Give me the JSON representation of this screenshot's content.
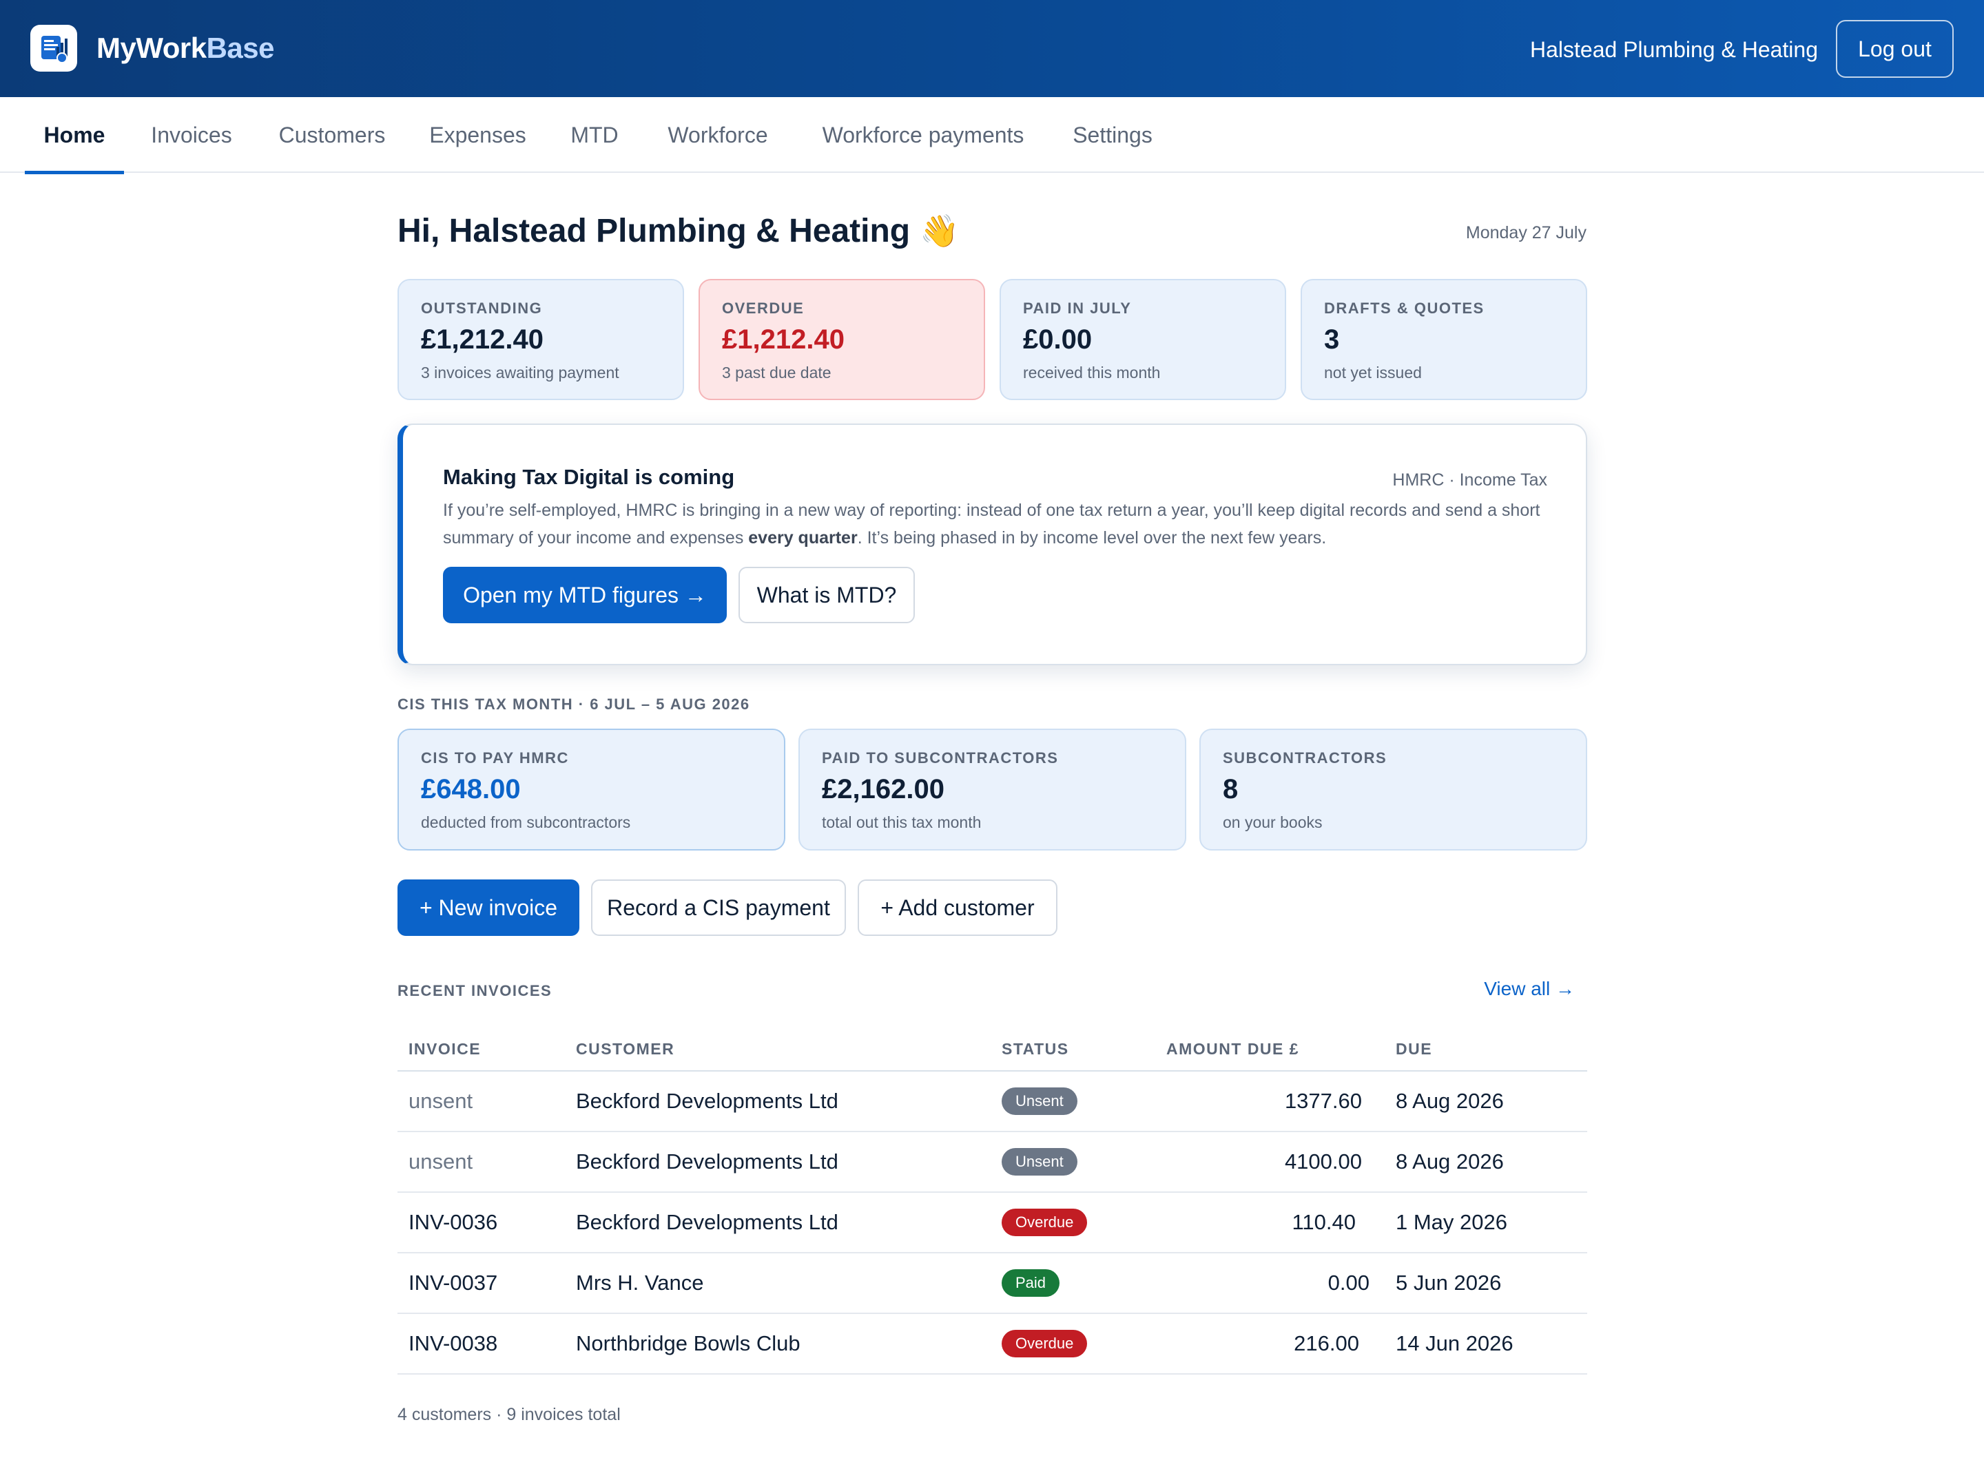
{
  "app": {
    "brand_main": "MyWork",
    "brand_accent": "Base",
    "company": "Halstead Plumbing & Heating",
    "logout_label": "Log out"
  },
  "nav": {
    "items": [
      {
        "label": "Home",
        "active": true
      },
      {
        "label": "Invoices"
      },
      {
        "label": "Customers"
      },
      {
        "label": "Expenses"
      },
      {
        "label": "MTD"
      },
      {
        "label": "Workforce"
      },
      {
        "label": "Workforce payments"
      },
      {
        "label": "Settings"
      }
    ]
  },
  "greeting": {
    "text": "Hi, Halstead Plumbing & Heating",
    "emoji": "👋",
    "date": "Monday 27 July"
  },
  "stats": [
    {
      "label": "OUTSTANDING",
      "value": "£1,212.40",
      "sub": "3 invoices awaiting payment"
    },
    {
      "label": "OVERDUE",
      "value": "£1,212.40",
      "sub": "3 past due date"
    },
    {
      "label": "PAID IN JULY",
      "value": "£0.00",
      "sub": "received this month"
    },
    {
      "label": "DRAFTS & QUOTES",
      "value": "3",
      "sub": "not yet issued"
    }
  ],
  "mtd": {
    "title": "Making Tax Digital is coming",
    "tag": "HMRC · Income Tax",
    "body_before": "If you’re self-employed, HMRC is bringing in a new way of reporting: instead of one tax return a year, you’ll keep digital records and send a short summary of your income and expenses ",
    "body_bold": "every quarter",
    "body_after": ". It’s being phased in by income level over the next few years.",
    "primary_button": "Open my MTD figures →",
    "secondary_button": "What is MTD?"
  },
  "cis": {
    "section_label": "CIS THIS TAX MONTH · 6 JUL – 5 AUG 2026",
    "cards": [
      {
        "label": "CIS TO PAY HMRC",
        "value": "£648.00",
        "sub": "deducted from subcontractors"
      },
      {
        "label": "PAID TO SUBCONTRACTORS",
        "value": "£2,162.00",
        "sub": "total out this tax month"
      },
      {
        "label": "SUBCONTRACTORS",
        "value": "8",
        "sub": "on your books"
      }
    ]
  },
  "actions": {
    "new_invoice": "+ New invoice",
    "record_cis": "Record a CIS payment",
    "add_customer": "+ Add customer"
  },
  "recent": {
    "section_label": "RECENT INVOICES",
    "view_all": "View all →",
    "headers": {
      "invoice": "INVOICE",
      "customer": "CUSTOMER",
      "status": "STATUS",
      "amount": "AMOUNT DUE £",
      "due": "DUE"
    },
    "rows": [
      {
        "invoice": "unsent",
        "customer": "Beckford Developments Ltd",
        "status": "Unsent",
        "amount": "1377.60",
        "due": "8 Aug 2026"
      },
      {
        "invoice": "unsent",
        "customer": "Beckford Developments Ltd",
        "status": "Unsent",
        "amount": "4100.00",
        "due": "8 Aug 2026"
      },
      {
        "invoice": "INV-0036",
        "customer": "Beckford Developments Ltd",
        "status": "Overdue",
        "amount": "110.40",
        "due": "1 May 2026"
      },
      {
        "invoice": "INV-0037",
        "customer": "Mrs H. Vance",
        "status": "Paid",
        "amount": "0.00",
        "due": "5 Jun 2026"
      },
      {
        "invoice": "INV-0038",
        "customer": "Northbridge Bowls Club",
        "status": "Overdue",
        "amount": "216.00",
        "due": "14 Jun 2026"
      }
    ]
  },
  "footer": {
    "summary": "4 customers · 9 invoices total"
  },
  "colors": {
    "primary": "#0b63c9",
    "header_dark": "#0b3b78",
    "danger": "#c21d24",
    "success": "#177a3a",
    "muted": "#6b7686"
  }
}
